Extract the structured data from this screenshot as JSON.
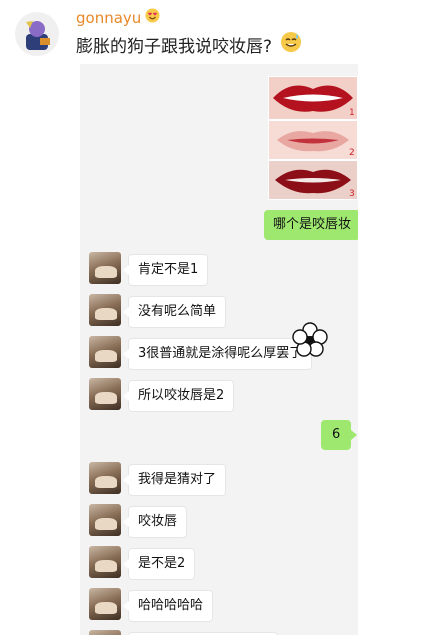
{
  "post": {
    "username": "gonnayu",
    "text": "膨胀的狗子跟我说咬妆唇?"
  },
  "chat": {
    "messages": [
      {
        "side": "right",
        "text": "哪个是咬唇妆"
      },
      {
        "side": "left",
        "text": "肯定不是1"
      },
      {
        "side": "left",
        "text": "没有呢么简单"
      },
      {
        "side": "left",
        "text": "3很普通就是涂得呢么厚罢了"
      },
      {
        "side": "left",
        "text": "所以咬妆唇是2"
      },
      {
        "side": "right",
        "text": "6"
      },
      {
        "side": "left",
        "text": "我得是猜对了"
      },
      {
        "side": "left",
        "text": "咬妆唇"
      },
      {
        "side": "left",
        "text": "是不是2"
      },
      {
        "side": "left",
        "text": "哈哈哈哈哈"
      }
    ],
    "lip_labels": [
      "1",
      "2",
      "3"
    ]
  },
  "colors": {
    "username": "#e8882a",
    "right_bubble": "#9fe870",
    "left_bubble": "#ffffff"
  }
}
